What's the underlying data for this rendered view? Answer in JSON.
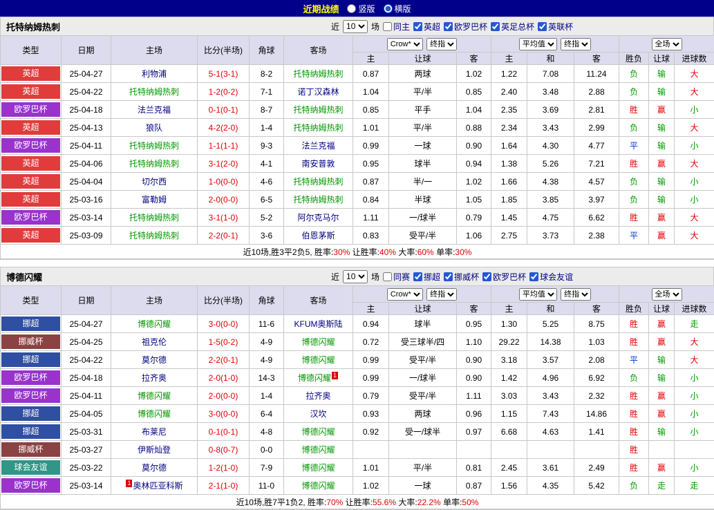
{
  "topbar": {
    "title": "近期战绩",
    "vertical": "竖版",
    "horizontal": "横版"
  },
  "labels": {
    "recent": "近",
    "matches": "场"
  },
  "columns": {
    "type": "类型",
    "date": "日期",
    "home": "主场",
    "score": "比分(半场)",
    "corner": "角球",
    "away": "客场",
    "bookmaker": "Crow*",
    "final_odds": "终指",
    "average": "平均值",
    "full_match": "全场",
    "sub_home": "主",
    "sub_away": "客",
    "sub_draw": "和",
    "sub_handicap": "让球",
    "sub_winlose": "胜负",
    "sub_goals": "进球数"
  },
  "colors": {
    "topbar_bg": "#00008B",
    "header_bg": "#DCDCEE",
    "self_team": "#009900",
    "opponent_team": "#000080",
    "score": "#E00000",
    "percent": "#E00000"
  },
  "league_colors": {
    "英超": "#e23b3b",
    "欧罗巴杯": "#9933cc",
    "挪超": "#2f4fa2",
    "挪威杯": "#8b4242",
    "球会友谊": "#2f9688"
  },
  "result_color_map": {
    "胜": "#e00000",
    "赢": "#e00000",
    "大": "#e00000",
    "负": "#009900",
    "输": "#009900",
    "小": "#009900",
    "走": "#009900",
    "平": "#0033cc"
  },
  "sections": [
    {
      "team": "托特纳姆热刺",
      "filter": {
        "count": "10",
        "same_label": "同主",
        "leagues": [
          "英超",
          "欧罗巴杯",
          "英足总杯",
          "英联杯"
        ]
      },
      "rows": [
        {
          "league": "英超",
          "date": "25-04-27",
          "home": "利物浦",
          "score": "5-1(3-1)",
          "corner": "8-2",
          "away": "托特纳姆热刺",
          "away_self": true,
          "ho": "0.87",
          "hc": "两球",
          "ao": "1.02",
          "m1": "1.22",
          "m2": "7.08",
          "m3": "11.24",
          "r1": "负",
          "r2": "输",
          "r3": "大"
        },
        {
          "league": "英超",
          "date": "25-04-22",
          "home": "托特纳姆热刺",
          "home_self": true,
          "score": "1-2(0-2)",
          "corner": "7-1",
          "away": "诺丁汉森林",
          "ho": "1.04",
          "hc": "平/半",
          "ao": "0.85",
          "m1": "2.40",
          "m2": "3.48",
          "m3": "2.88",
          "r1": "负",
          "r2": "输",
          "r3": "大"
        },
        {
          "league": "欧罗巴杯",
          "date": "25-04-18",
          "home": "法兰克福",
          "score": "0-1(0-1)",
          "corner": "8-7",
          "away": "托特纳姆热刺",
          "away_self": true,
          "ho": "0.85",
          "hc": "平手",
          "ao": "1.04",
          "m1": "2.35",
          "m2": "3.69",
          "m3": "2.81",
          "r1": "胜",
          "r2": "赢",
          "r3": "小"
        },
        {
          "league": "英超",
          "date": "25-04-13",
          "home": "狼队",
          "score": "4-2(2-0)",
          "corner": "1-4",
          "away": "托特纳姆热刺",
          "away_self": true,
          "ho": "1.01",
          "hc": "平/半",
          "ao": "0.88",
          "m1": "2.34",
          "m2": "3.43",
          "m3": "2.99",
          "r1": "负",
          "r2": "输",
          "r3": "大"
        },
        {
          "league": "欧罗巴杯",
          "date": "25-04-11",
          "home": "托特纳姆热刺",
          "home_self": true,
          "score": "1-1(1-1)",
          "corner": "9-3",
          "away": "法兰克福",
          "ho": "0.99",
          "hc": "一球",
          "ao": "0.90",
          "m1": "1.64",
          "m2": "4.30",
          "m3": "4.77",
          "r1": "平",
          "r2": "输",
          "r3": "小"
        },
        {
          "league": "英超",
          "date": "25-04-06",
          "home": "托特纳姆热刺",
          "home_self": true,
          "score": "3-1(2-0)",
          "corner": "4-1",
          "away": "南安普敦",
          "ho": "0.95",
          "hc": "球半",
          "ao": "0.94",
          "m1": "1.38",
          "m2": "5.26",
          "m3": "7.21",
          "r1": "胜",
          "r2": "赢",
          "r3": "大"
        },
        {
          "league": "英超",
          "date": "25-04-04",
          "home": "切尔西",
          "score": "1-0(0-0)",
          "corner": "4-6",
          "away": "托特纳姆热刺",
          "away_self": true,
          "ho": "0.87",
          "hc": "半/一",
          "ao": "1.02",
          "m1": "1.66",
          "m2": "4.38",
          "m3": "4.57",
          "r1": "负",
          "r2": "输",
          "r3": "小"
        },
        {
          "league": "英超",
          "date": "25-03-16",
          "home": "富勒姆",
          "score": "2-0(0-0)",
          "corner": "6-5",
          "away": "托特纳姆热刺",
          "away_self": true,
          "ho": "0.84",
          "hc": "半球",
          "ao": "1.05",
          "m1": "1.85",
          "m2": "3.85",
          "m3": "3.97",
          "r1": "负",
          "r2": "输",
          "r3": "小"
        },
        {
          "league": "欧罗巴杯",
          "date": "25-03-14",
          "home": "托特纳姆热刺",
          "home_self": true,
          "score": "3-1(1-0)",
          "corner": "5-2",
          "away": "阿尔克马尔",
          "ho": "1.11",
          "hc": "一/球半",
          "ao": "0.79",
          "m1": "1.45",
          "m2": "4.75",
          "m3": "6.62",
          "r1": "胜",
          "r2": "赢",
          "r3": "大"
        },
        {
          "league": "英超",
          "date": "25-03-09",
          "home": "托特纳姆热刺",
          "home_self": true,
          "score": "2-2(0-1)",
          "corner": "3-6",
          "away": "伯恩茅斯",
          "ho": "0.83",
          "hc": "受平/半",
          "ao": "1.06",
          "m1": "2.75",
          "m2": "3.73",
          "m3": "2.38",
          "r1": "平",
          "r2": "赢",
          "r3": "大"
        }
      ],
      "summary": [
        {
          "t": "近10场,胜3平2负5, 胜率:",
          "red": false
        },
        {
          "t": "30%",
          "red": true
        },
        {
          "t": " 让胜率:",
          "red": false
        },
        {
          "t": "40%",
          "red": true
        },
        {
          "t": " 大率:",
          "red": false
        },
        {
          "t": "60%",
          "red": true
        },
        {
          "t": " 单率:",
          "red": false
        },
        {
          "t": "30%",
          "red": true
        }
      ]
    },
    {
      "team": "博德闪耀",
      "filter": {
        "count": "10",
        "same_label": "同赛",
        "leagues": [
          "挪超",
          "挪威杯",
          "欧罗巴杯",
          "球会友谊"
        ]
      },
      "rows": [
        {
          "league": "挪超",
          "date": "25-04-27",
          "home": "博德闪耀",
          "home_self": true,
          "score": "3-0(0-0)",
          "corner": "11-6",
          "away": "KFUM奥斯陆",
          "ho": "0.94",
          "hc": "球半",
          "ao": "0.95",
          "m1": "1.30",
          "m2": "5.25",
          "m3": "8.75",
          "r1": "胜",
          "r2": "赢",
          "r3": "走"
        },
        {
          "league": "挪威杯",
          "date": "25-04-25",
          "home": "祖克伦",
          "score": "1-5(0-2)",
          "corner": "4-9",
          "away": "博德闪耀",
          "away_self": true,
          "ho": "0.72",
          "hc": "受三球半/四",
          "ao": "1.10",
          "m1": "29.22",
          "m2": "14.38",
          "m3": "1.03",
          "r1": "胜",
          "r2": "赢",
          "r3": "大"
        },
        {
          "league": "挪超",
          "date": "25-04-22",
          "home": "莫尔德",
          "score": "2-2(0-1)",
          "corner": "4-9",
          "away": "博德闪耀",
          "away_self": true,
          "ho": "0.99",
          "hc": "受平/半",
          "ao": "0.90",
          "m1": "3.18",
          "m2": "3.57",
          "m3": "2.08",
          "r1": "平",
          "r2": "输",
          "r3": "大"
        },
        {
          "league": "欧罗巴杯",
          "date": "25-04-18",
          "home": "拉齐奥",
          "score": "2-0(1-0)",
          "corner": "14-3",
          "away": "博德闪耀",
          "away_self": true,
          "away_card": "1",
          "ho": "0.99",
          "hc": "一/球半",
          "ao": "0.90",
          "m1": "1.42",
          "m2": "4.96",
          "m3": "6.92",
          "r1": "负",
          "r2": "输",
          "r3": "小"
        },
        {
          "league": "欧罗巴杯",
          "date": "25-04-11",
          "home": "博德闪耀",
          "home_self": true,
          "score": "2-0(0-0)",
          "corner": "1-4",
          "away": "拉齐奥",
          "ho": "0.79",
          "hc": "受平/半",
          "ao": "1.11",
          "m1": "3.03",
          "m2": "3.43",
          "m3": "2.32",
          "r1": "胜",
          "r2": "赢",
          "r3": "小"
        },
        {
          "league": "挪超",
          "date": "25-04-05",
          "home": "博德闪耀",
          "home_self": true,
          "score": "3-0(0-0)",
          "corner": "6-4",
          "away": "汉坎",
          "ho": "0.93",
          "hc": "两球",
          "ao": "0.96",
          "m1": "1.15",
          "m2": "7.43",
          "m3": "14.86",
          "r1": "胜",
          "r2": "赢",
          "r3": "小"
        },
        {
          "league": "挪超",
          "date": "25-03-31",
          "home": "布莱尼",
          "score": "0-1(0-1)",
          "corner": "4-8",
          "away": "博德闪耀",
          "away_self": true,
          "ho": "0.92",
          "hc": "受一/球半",
          "ao": "0.97",
          "m1": "6.68",
          "m2": "4.63",
          "m3": "1.41",
          "r1": "胜",
          "r2": "输",
          "r3": "小"
        },
        {
          "league": "挪威杯",
          "date": "25-03-27",
          "home": "伊斯灿登",
          "score": "0-8(0-7)",
          "corner": "0-0",
          "away": "博德闪耀",
          "away_self": true,
          "ho": "",
          "hc": "",
          "ao": "",
          "m1": "",
          "m2": "",
          "m3": "",
          "r1": "胜",
          "r2": "",
          "r3": ""
        },
        {
          "league": "球会友谊",
          "date": "25-03-22",
          "home": "莫尔德",
          "score": "1-2(1-0)",
          "corner": "7-9",
          "away": "博德闪耀",
          "away_self": true,
          "ho": "1.01",
          "hc": "平/半",
          "ao": "0.81",
          "m1": "2.45",
          "m2": "3.61",
          "m3": "2.49",
          "r1": "胜",
          "r2": "赢",
          "r3": "小"
        },
        {
          "league": "欧罗巴杯",
          "date": "25-03-14",
          "home": "奥林匹亚科斯",
          "home_card": "1",
          "score": "2-1(1-0)",
          "corner": "11-0",
          "away": "博德闪耀",
          "away_self": true,
          "ho": "1.02",
          "hc": "一球",
          "ao": "0.87",
          "m1": "1.56",
          "m2": "4.35",
          "m3": "5.42",
          "r1": "负",
          "r2": "走",
          "r3": "走"
        }
      ],
      "summary": [
        {
          "t": "近10场,胜7平1负2, 胜率:",
          "red": false
        },
        {
          "t": "70%",
          "red": true
        },
        {
          "t": " 让胜率:",
          "red": false
        },
        {
          "t": "55.6%",
          "red": true
        },
        {
          "t": " 大率:",
          "red": false
        },
        {
          "t": "22.2%",
          "red": true
        },
        {
          "t": " 单率:",
          "red": false
        },
        {
          "t": "50%",
          "red": true
        }
      ]
    }
  ]
}
